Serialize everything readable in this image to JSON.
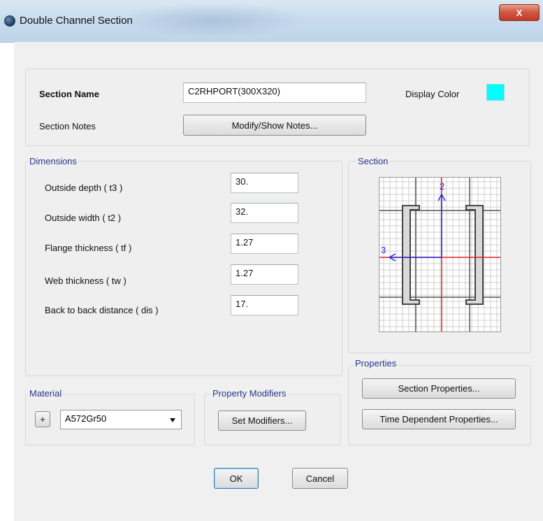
{
  "window": {
    "title": "Double Channel Section",
    "close_label": "X"
  },
  "header": {
    "section_name_label": "Section Name",
    "section_name_value": "C2RHPORT(300X320)",
    "display_color_label": "Display Color",
    "display_color": "#00ffff",
    "section_notes_label": "Section Notes",
    "notes_button": "Modify/Show Notes..."
  },
  "dimensions": {
    "title": "Dimensions",
    "fields": [
      {
        "label": "Outside depth  ( t3 )",
        "value": "30."
      },
      {
        "label": "Outside width  ( t2 )",
        "value": "32."
      },
      {
        "label": "Flange thickness  ( tf )",
        "value": "1.27"
      },
      {
        "label": "Web thickness  ( tw )",
        "value": "1.27"
      },
      {
        "label": "Back to back distance  ( dis )",
        "value": "17."
      }
    ]
  },
  "section": {
    "title": "Section",
    "axis_vertical": "2",
    "axis_horizontal": "3",
    "axis_color": "#2a2ae0",
    "centerline_color": "#e02020"
  },
  "properties": {
    "title": "Properties",
    "section_properties_button": "Section Properties...",
    "time_dependent_button": "Time Dependent Properties..."
  },
  "material": {
    "title": "Material",
    "plus_label": "+",
    "selected": "A572Gr50"
  },
  "modifiers": {
    "title": "Property Modifiers",
    "set_button": "Set Modifiers..."
  },
  "footer": {
    "ok_label": "OK",
    "cancel_label": "Cancel"
  }
}
